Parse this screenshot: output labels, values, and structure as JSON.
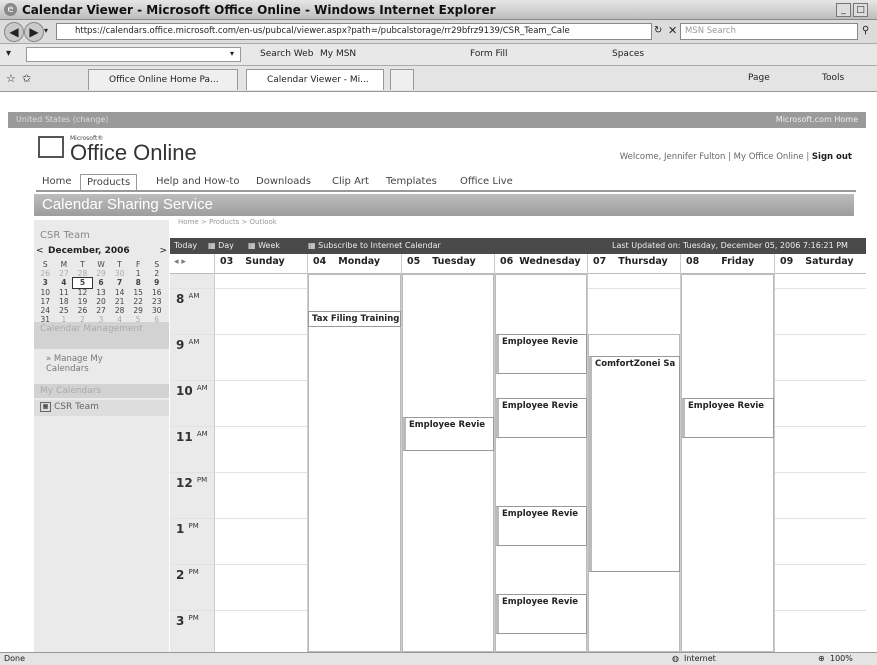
{
  "window": {
    "title": "Calendar Viewer - Microsoft Office Online - Windows Internet Explorer",
    "min": "_",
    "max": "□"
  },
  "address": {
    "url": "https://calendars.office.microsoft.com/en-us/pubcal/viewer.aspx?path=/pubcalstorage/rr29bfrz9139/CSR_Team_Cale",
    "search_placeholder": "MSN Search"
  },
  "toolbar": {
    "search_web": "Search Web",
    "my_msn": "My MSN",
    "form_fill": "Form Fill",
    "spaces": "Spaces"
  },
  "tabs": [
    {
      "label": "Office Online Home Pa..."
    },
    {
      "label": "Calendar Viewer - Mi..."
    }
  ],
  "tab_tools": {
    "page": "Page",
    "tools": "Tools"
  },
  "site": {
    "region": "United States (change)",
    "ms_home": "Microsoft.com Home",
    "logo_small": "Microsoft®",
    "logo": "Office Online",
    "welcome_prefix": "Welcome, Jennifer Fulton | My Office Online |",
    "sign_out": "Sign out",
    "nav": [
      "Home",
      "Products",
      "Help and How-to",
      "Downloads",
      "Clip Art",
      "Templates",
      "Office Live"
    ],
    "banner": "Calendar Sharing Service",
    "breadcrumb": "Home > Products > Outlook"
  },
  "left": {
    "title": "CSR Team",
    "month": "December, 2006",
    "prev": "<",
    "next": ">",
    "weekdays": [
      "S",
      "M",
      "T",
      "W",
      "T",
      "F",
      "S"
    ],
    "weeks": [
      [
        "26",
        "27",
        "28",
        "29",
        "30",
        "1",
        "2"
      ],
      [
        "3",
        "4",
        "5",
        "6",
        "7",
        "8",
        "9"
      ],
      [
        "10",
        "11",
        "12",
        "13",
        "14",
        "15",
        "16"
      ],
      [
        "17",
        "18",
        "19",
        "20",
        "21",
        "22",
        "23"
      ],
      [
        "24",
        "25",
        "26",
        "27",
        "28",
        "29",
        "30"
      ],
      [
        "31",
        "1",
        "2",
        "3",
        "4",
        "5",
        "6"
      ]
    ],
    "calendar_management": "Calendar Management",
    "manage_link": "» Manage My Calendars",
    "my_calendars": "My Calendars",
    "csr_team": "CSR Team"
  },
  "calbar": {
    "today": "Today",
    "day": "Day",
    "week": "Week",
    "subscribe": "Subscribe to Internet Calendar",
    "updated": "Last Updated on: Tuesday, December 05, 2006 7:16:21 PM"
  },
  "days": [
    {
      "num": "03",
      "name": "Sunday"
    },
    {
      "num": "04",
      "name": "Monday"
    },
    {
      "num": "05",
      "name": "Tuesday"
    },
    {
      "num": "06",
      "name": "Wednesday"
    },
    {
      "num": "07",
      "name": "Thursday"
    },
    {
      "num": "08",
      "name": "Friday"
    },
    {
      "num": "09",
      "name": "Saturday"
    }
  ],
  "hours": [
    {
      "h": "8",
      "ap": "AM"
    },
    {
      "h": "9",
      "ap": "AM"
    },
    {
      "h": "10",
      "ap": "AM"
    },
    {
      "h": "11",
      "ap": "AM"
    },
    {
      "h": "12",
      "ap": "PM"
    },
    {
      "h": "1",
      "ap": "PM"
    },
    {
      "h": "2",
      "ap": "PM"
    },
    {
      "h": "3",
      "ap": "PM"
    }
  ],
  "events": {
    "mon_tax": "Tax Filing Training",
    "tue_review": "Employee Revie",
    "wed_9": "Employee Revie",
    "wed_10": "Employee Revie",
    "wed_1": "Employee Revie",
    "wed_3": "Employee Revie",
    "thu_comfort": "ComfortZonei Sa",
    "fri_review": "Employee Revie"
  },
  "status": {
    "left": "Done",
    "zone": "Internet",
    "zoom": "100%"
  }
}
